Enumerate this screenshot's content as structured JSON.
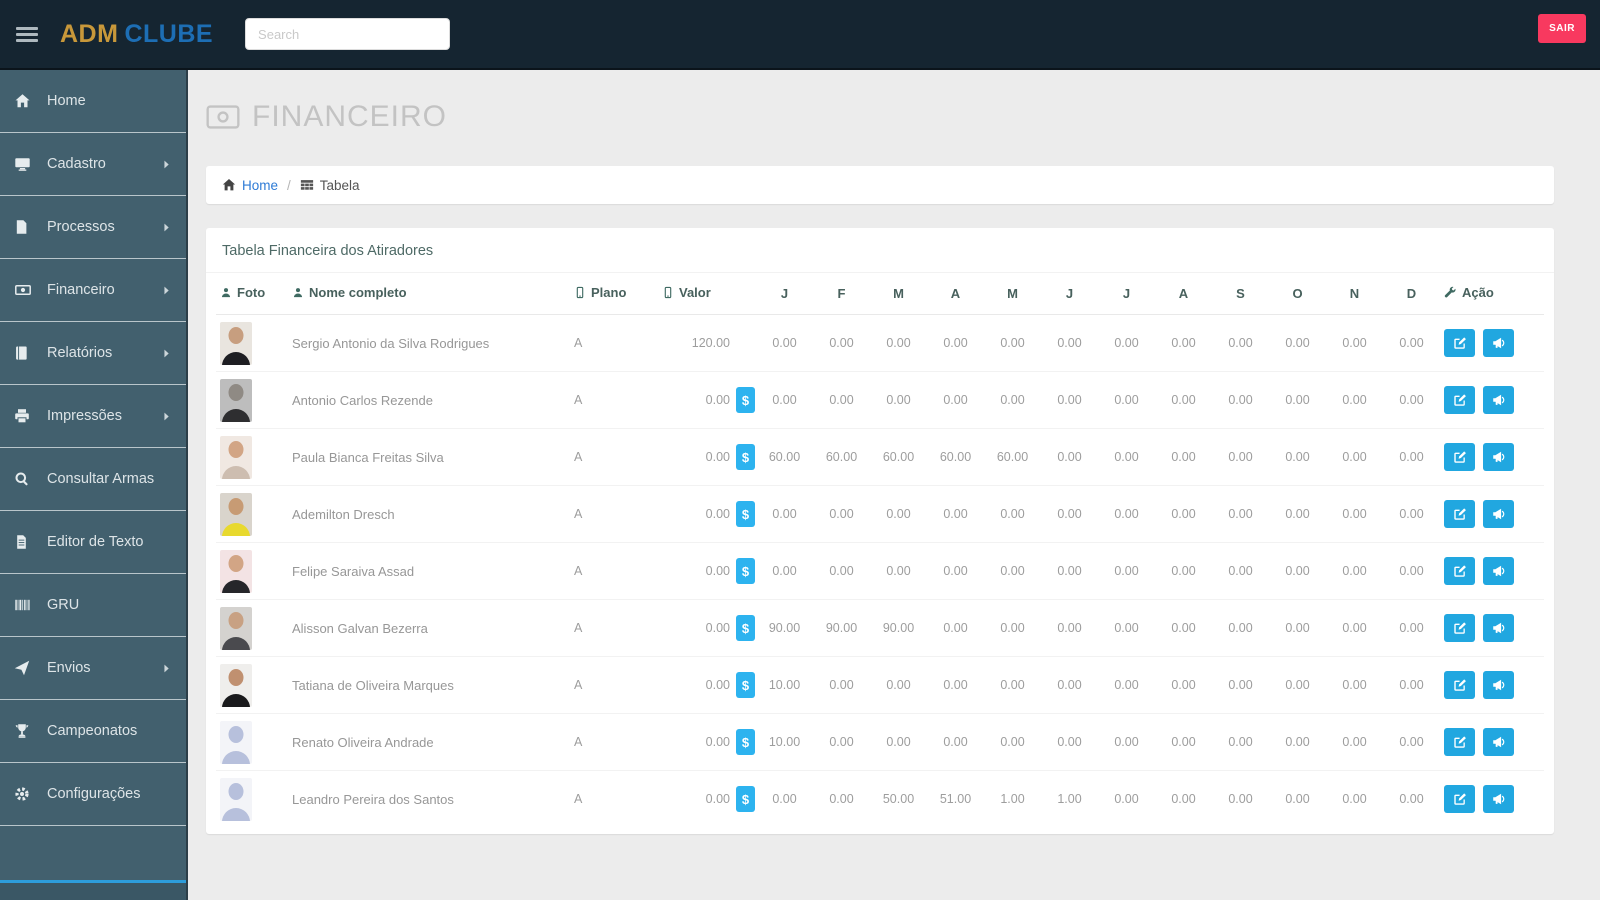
{
  "topbar": {
    "logo_adm": "ADM",
    "logo_clube": "CLUBE",
    "search_placeholder": "Search",
    "logout_label": "SAIR"
  },
  "sidebar": {
    "items": [
      {
        "label": "Home",
        "icon": "home",
        "chevron": false
      },
      {
        "label": "Cadastro",
        "icon": "desktop",
        "chevron": true
      },
      {
        "label": "Processos",
        "icon": "file",
        "chevron": true
      },
      {
        "label": "Financeiro",
        "icon": "money",
        "chevron": true
      },
      {
        "label": "Relatórios",
        "icon": "book",
        "chevron": true
      },
      {
        "label": "Impressões",
        "icon": "printer",
        "chevron": true
      },
      {
        "label": "Consultar Armas",
        "icon": "search",
        "chevron": false
      },
      {
        "label": "Editor de Texto",
        "icon": "file-text",
        "chevron": false
      },
      {
        "label": "GRU",
        "icon": "barcode",
        "chevron": false
      },
      {
        "label": "Envios",
        "icon": "paper-plane",
        "chevron": true
      },
      {
        "label": "Campeonatos",
        "icon": "trophy",
        "chevron": false
      },
      {
        "label": "Configurações",
        "icon": "gear",
        "chevron": false
      }
    ]
  },
  "page": {
    "title": "FINANCEIRO",
    "breadcrumb": {
      "home": "Home",
      "separator": "/",
      "current": "Tabela"
    }
  },
  "panel": {
    "heading": "Tabela Financeira dos Atiradores"
  },
  "table": {
    "badge_symbol": "$",
    "headers": {
      "foto": "Foto",
      "nome": "Nome completo",
      "plano": "Plano",
      "valor": "Valor",
      "months": [
        "J",
        "F",
        "M",
        "A",
        "M",
        "J",
        "J",
        "A",
        "S",
        "O",
        "N",
        "D"
      ],
      "acao": "Ação"
    },
    "rows": [
      {
        "name": "Sergio Antonio da Silva Rodrigues",
        "plano": "A",
        "valor": "120.00",
        "valor_badge": false,
        "months": [
          "0.00",
          "0.00",
          "0.00",
          "0.00",
          "0.00",
          "0.00",
          "0.00",
          "0.00",
          "0.00",
          "0.00",
          "0.00",
          "0.00"
        ],
        "avatar": {
          "type": "photo",
          "bg": "#e9e5df",
          "head": "#c79e7f",
          "torso": "#1e1e22"
        }
      },
      {
        "name": "Antonio Carlos Rezende",
        "plano": "A",
        "valor": "0.00",
        "valor_badge": true,
        "months": [
          "0.00",
          "0.00",
          "0.00",
          "0.00",
          "0.00",
          "0.00",
          "0.00",
          "0.00",
          "0.00",
          "0.00",
          "0.00",
          "0.00"
        ],
        "avatar": {
          "type": "photo",
          "bg": "#bdbdbd",
          "head": "#8f8a84",
          "torso": "#2e2e30"
        }
      },
      {
        "name": "Paula Bianca Freitas Silva",
        "plano": "A",
        "valor": "0.00",
        "valor_badge": true,
        "months": [
          "60.00",
          "60.00",
          "60.00",
          "60.00",
          "60.00",
          "0.00",
          "0.00",
          "0.00",
          "0.00",
          "0.00",
          "0.00",
          "0.00"
        ],
        "avatar": {
          "type": "photo",
          "bg": "#f0e8e2",
          "head": "#d2a585",
          "torso": "#cdbdb0"
        }
      },
      {
        "name": "Ademilton Dresch",
        "plano": "A",
        "valor": "0.00",
        "valor_badge": true,
        "months": [
          "0.00",
          "0.00",
          "0.00",
          "0.00",
          "0.00",
          "0.00",
          "0.00",
          "0.00",
          "0.00",
          "0.00",
          "0.00",
          "0.00"
        ],
        "avatar": {
          "type": "photo",
          "bg": "#d9d4cc",
          "head": "#c79b74",
          "torso": "#e8d92e"
        }
      },
      {
        "name": "Felipe Saraiva Assad",
        "plano": "A",
        "valor": "0.00",
        "valor_badge": true,
        "months": [
          "0.00",
          "0.00",
          "0.00",
          "0.00",
          "0.00",
          "0.00",
          "0.00",
          "0.00",
          "0.00",
          "0.00",
          "0.00",
          "0.00"
        ],
        "avatar": {
          "type": "photo",
          "bg": "#f3e3e4",
          "head": "#d2a585",
          "torso": "#26262a"
        }
      },
      {
        "name": "Alisson Galvan Bezerra",
        "plano": "A",
        "valor": "0.00",
        "valor_badge": true,
        "months": [
          "90.00",
          "90.00",
          "90.00",
          "0.00",
          "0.00",
          "0.00",
          "0.00",
          "0.00",
          "0.00",
          "0.00",
          "0.00",
          "0.00"
        ],
        "avatar": {
          "type": "photo",
          "bg": "#d4d2cf",
          "head": "#c8a183",
          "torso": "#4a4a4e"
        }
      },
      {
        "name": "Tatiana de Oliveira Marques",
        "plano": "A",
        "valor": "0.00",
        "valor_badge": true,
        "months": [
          "10.00",
          "0.00",
          "0.00",
          "0.00",
          "0.00",
          "0.00",
          "0.00",
          "0.00",
          "0.00",
          "0.00",
          "0.00",
          "0.00"
        ],
        "avatar": {
          "type": "photo",
          "bg": "#efeeec",
          "head": "#c09070",
          "torso": "#1a1a1c"
        }
      },
      {
        "name": "Renato Oliveira Andrade",
        "plano": "A",
        "valor": "0.00",
        "valor_badge": true,
        "months": [
          "10.00",
          "0.00",
          "0.00",
          "0.00",
          "0.00",
          "0.00",
          "0.00",
          "0.00",
          "0.00",
          "0.00",
          "0.00",
          "0.00"
        ],
        "avatar": {
          "type": "placeholder",
          "bg": "#f3f4f8",
          "head": "#b7c0dc",
          "torso": "#b7c0dc"
        }
      },
      {
        "name": "Leandro Pereira dos Santos",
        "plano": "A",
        "valor": "0.00",
        "valor_badge": true,
        "months": [
          "0.00",
          "0.00",
          "50.00",
          "51.00",
          "1.00",
          "1.00",
          "0.00",
          "0.00",
          "0.00",
          "0.00",
          "0.00",
          "0.00"
        ],
        "avatar": {
          "type": "placeholder",
          "bg": "#f3f4f8",
          "head": "#b7c0dc",
          "torso": "#b7c0dc"
        }
      }
    ]
  },
  "colors": {
    "topbar_bg": "#152531",
    "sidebar_bg": "#42606e",
    "accent_blue": "#21a7e0",
    "badge_blue": "#2db3ef",
    "logout_red": "#f8395f",
    "logo_gold": "#c8983a",
    "logo_blue": "#1d6eb4",
    "link_blue": "#2e7bd6"
  }
}
